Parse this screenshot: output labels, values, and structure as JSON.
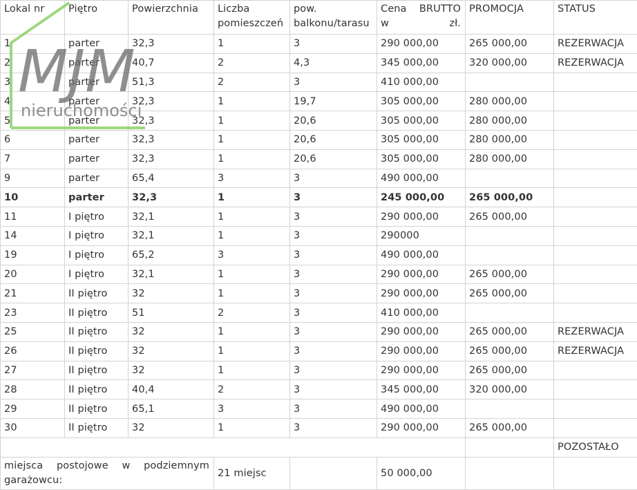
{
  "headers": [
    "Lokal nr",
    "Piętro",
    "Powierzchnia",
    "Liczba pomieszczeń",
    "pow. balkonu/tarasu",
    "Cena BRUTTO w zł.",
    "PROMOCJA",
    "STATUS"
  ],
  "rows": [
    {
      "nr": "1",
      "floor": "parter",
      "area": "32,3",
      "rooms": "1",
      "balcony": "3",
      "price": "290 000,00",
      "promo": "265 000,00",
      "status": "REZERWACJA"
    },
    {
      "nr": "2",
      "floor": "parter",
      "area": "40,7",
      "rooms": "2",
      "balcony": "4,3",
      "price": "345 000,00",
      "promo": "320 000,00",
      "status": "REZERWACJA"
    },
    {
      "nr": "3",
      "floor": "parter",
      "area": "51,3",
      "rooms": "2",
      "balcony": "3",
      "price": "410 000,00",
      "promo": "",
      "status": ""
    },
    {
      "nr": "4",
      "floor": "parter",
      "area": "32,3",
      "rooms": "1",
      "balcony": "19,7",
      "price": "305 000,00",
      "promo": "280 000,00",
      "status": ""
    },
    {
      "nr": "5",
      "floor": "parter",
      "area": "32,3",
      "rooms": "1",
      "balcony": "20,6",
      "price": "305 000,00",
      "promo": "280 000,00",
      "status": ""
    },
    {
      "nr": "6",
      "floor": "parter",
      "area": "32,3",
      "rooms": "1",
      "balcony": "20,6",
      "price": "305 000,00",
      "promo": "280 000,00",
      "status": ""
    },
    {
      "nr": "7",
      "floor": "parter",
      "area": "32,3",
      "rooms": "1",
      "balcony": "20,6",
      "price": "305 000,00",
      "promo": "280 000,00",
      "status": ""
    },
    {
      "nr": "9",
      "floor": "parter",
      "area": "65,4",
      "rooms": "3",
      "balcony": "3",
      "price": "490 000,00",
      "promo": "",
      "status": ""
    },
    {
      "nr": "10",
      "floor": "parter",
      "area": "32,3",
      "rooms": "1",
      "balcony": "3",
      "price": "245 000,00",
      "promo": "265 000,00",
      "status": "",
      "bold": true
    },
    {
      "nr": "11",
      "floor": "I piętro",
      "area": "32,1",
      "rooms": "1",
      "balcony": "3",
      "price": "290 000,00",
      "promo": "265 000,00",
      "status": ""
    },
    {
      "nr": "14",
      "floor": "I piętro",
      "area": "32,1",
      "rooms": "1",
      "balcony": "3",
      "price": "290000",
      "promo": "",
      "status": ""
    },
    {
      "nr": "19",
      "floor": "I piętro",
      "area": "65,2",
      "rooms": "3",
      "balcony": "3",
      "price": "490 000,00",
      "promo": "",
      "status": ""
    },
    {
      "nr": "20",
      "floor": "I piętro",
      "area": "32,1",
      "rooms": "1",
      "balcony": "3",
      "price": "290 000,00",
      "promo": "265 000,00",
      "status": ""
    },
    {
      "nr": "21",
      "floor": "II piętro",
      "area": "32",
      "rooms": "1",
      "balcony": "3",
      "price": "290 000,00",
      "promo": "265 000,00",
      "status": ""
    },
    {
      "nr": "23",
      "floor": "II piętro",
      "area": "51",
      "rooms": "2",
      "balcony": "3",
      "price": "410 000,00",
      "promo": "",
      "status": ""
    },
    {
      "nr": "25",
      "floor": "II piętro",
      "area": "32",
      "rooms": "1",
      "balcony": "3",
      "price": "290 000,00",
      "promo": "265 000,00",
      "status": "REZERWACJA"
    },
    {
      "nr": "26",
      "floor": "II piętro",
      "area": "32",
      "rooms": "1",
      "balcony": "3",
      "price": "290 000,00",
      "promo": "265 000,00",
      "status": "REZERWACJA"
    },
    {
      "nr": "27",
      "floor": "II piętro",
      "area": "32",
      "rooms": "1",
      "balcony": "3",
      "price": "290 000,00",
      "promo": "265 000,00",
      "status": ""
    },
    {
      "nr": "28",
      "floor": "II piętro",
      "area": "40,4",
      "rooms": "2",
      "balcony": "3",
      "price": "345 000,00",
      "promo": "320 000,00",
      "status": ""
    },
    {
      "nr": "29",
      "floor": "II piętro",
      "area": "65,1",
      "rooms": "3",
      "balcony": "3",
      "price": "490 000,00",
      "promo": "",
      "status": ""
    },
    {
      "nr": "30",
      "floor": "II piętro",
      "area": "32",
      "rooms": "1",
      "balcony": "3",
      "price": "290 000,00",
      "promo": "265 000,00",
      "status": ""
    }
  ],
  "remaining_label": "POZOSTAŁO",
  "parking": {
    "label": "miejsca postojowe w podziemnym garażowcu:",
    "count": "21 miejsc",
    "price": "50 000,00"
  },
  "logo": {
    "text": "MJM",
    "subtext": "nieruchomości",
    "color_frame": "#8fcf6a",
    "color_text": "#6d6d6d"
  }
}
